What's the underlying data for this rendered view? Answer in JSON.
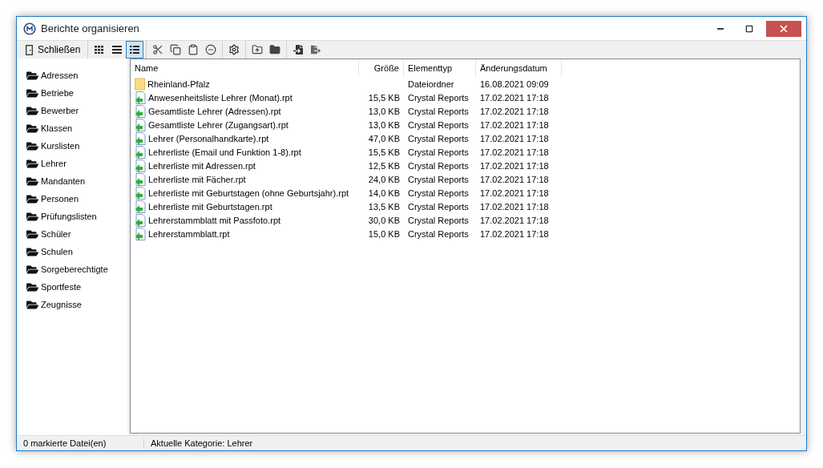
{
  "window": {
    "title": "Berichte organisieren"
  },
  "toolbar": {
    "close_label": "Schließen",
    "view_buttons": [
      {
        "selected": false
      },
      {
        "selected": false
      },
      {
        "selected": true
      }
    ]
  },
  "sidebar": {
    "items": [
      "Adressen",
      "Betriebe",
      "Bewerber",
      "Klassen",
      "Kurslisten",
      "Lehrer",
      "Mandanten",
      "Personen",
      "Prüfungslisten",
      "Schüler",
      "Schulen",
      "Sorgeberechtigte",
      "Sportfeste",
      "Zeugnisse"
    ]
  },
  "table": {
    "columns": [
      "Name",
      "Größe",
      "Elementtyp",
      "Änderungsdatum"
    ],
    "rows": [
      {
        "kind": "folder",
        "name": "Rheinland-Pfalz",
        "size": "",
        "type": "Dateiordner",
        "date": "16.08.2021 09:09"
      },
      {
        "kind": "report",
        "name": "Anwesenheitsliste Lehrer (Monat).rpt",
        "size": "15,5 KB",
        "type": "Crystal Reports",
        "date": "17.02.2021 17:18"
      },
      {
        "kind": "report",
        "name": "Gesamtliste Lehrer (Adressen).rpt",
        "size": "13,0 KB",
        "type": "Crystal Reports",
        "date": "17.02.2021 17:18"
      },
      {
        "kind": "report",
        "name": "Gesamtliste Lehrer (Zugangsart).rpt",
        "size": "13,0 KB",
        "type": "Crystal Reports",
        "date": "17.02.2021 17:18"
      },
      {
        "kind": "report",
        "name": "Lehrer (Personalhandkarte).rpt",
        "size": "47,0 KB",
        "type": "Crystal Reports",
        "date": "17.02.2021 17:18"
      },
      {
        "kind": "report",
        "name": "Lehrerliste (Email und Funktion 1-8).rpt",
        "size": "15,5 KB",
        "type": "Crystal Reports",
        "date": "17.02.2021 17:18"
      },
      {
        "kind": "report",
        "name": "Lehrerliste mit Adressen.rpt",
        "size": "12,5 KB",
        "type": "Crystal Reports",
        "date": "17.02.2021 17:18"
      },
      {
        "kind": "report",
        "name": "Lehrerliste mit Fächer.rpt",
        "size": "24,0 KB",
        "type": "Crystal Reports",
        "date": "17.02.2021 17:18"
      },
      {
        "kind": "report",
        "name": "Lehrerliste mit Geburtstagen (ohne Geburtsjahr).rpt",
        "size": "14,0 KB",
        "type": "Crystal Reports",
        "date": "17.02.2021 17:18"
      },
      {
        "kind": "report",
        "name": "Lehrerliste mit Geburtstagen.rpt",
        "size": "13,5 KB",
        "type": "Crystal Reports",
        "date": "17.02.2021 17:18"
      },
      {
        "kind": "report",
        "name": "Lehrerstammblatt mit Passfoto.rpt",
        "size": "30,0 KB",
        "type": "Crystal Reports",
        "date": "17.02.2021 17:18"
      },
      {
        "kind": "report",
        "name": "Lehrerstammblatt.rpt",
        "size": "15,0 KB",
        "type": "Crystal Reports",
        "date": "17.02.2021 17:18"
      }
    ]
  },
  "status_bar": {
    "selection": "0 markierte Datei(en)",
    "category": "Aktuelle Kategorie: Lehrer"
  }
}
